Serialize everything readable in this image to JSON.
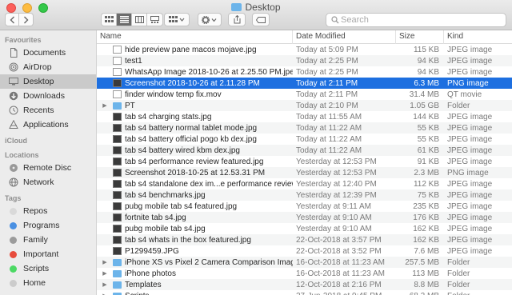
{
  "window": {
    "title": "Desktop"
  },
  "search": {
    "placeholder": "Search"
  },
  "sidebar": {
    "sections": [
      {
        "title": "Favourites",
        "items": [
          {
            "label": "Documents",
            "icon": "documents-icon"
          },
          {
            "label": "AirDrop",
            "icon": "airdrop-icon"
          },
          {
            "label": "Desktop",
            "icon": "desktop-icon",
            "selected": true
          },
          {
            "label": "Downloads",
            "icon": "downloads-icon"
          },
          {
            "label": "Recents",
            "icon": "recents-icon"
          },
          {
            "label": "Applications",
            "icon": "applications-icon"
          }
        ]
      },
      {
        "title": "iCloud",
        "items": []
      },
      {
        "title": "Locations",
        "items": [
          {
            "label": "Remote Disc",
            "icon": "remote-disc-icon"
          },
          {
            "label": "Network",
            "icon": "network-icon"
          }
        ]
      },
      {
        "title": "Tags",
        "items": [
          {
            "label": "Repos",
            "color": "#d9d9d9"
          },
          {
            "label": "Programs",
            "color": "#4a90e2"
          },
          {
            "label": "Family",
            "color": "#9b9b9b"
          },
          {
            "label": "Important",
            "color": "#e74c3c"
          },
          {
            "label": "Scripts",
            "color": "#4cd964"
          },
          {
            "label": "Home",
            "color": "#cccccc"
          }
        ]
      }
    ]
  },
  "columns": {
    "name": "Name",
    "date": "Date Modified",
    "size": "Size",
    "kind": "Kind"
  },
  "files": [
    {
      "name": "hide preview pane macos mojave.jpg",
      "date": "Today at 5:09 PM",
      "size": "115 KB",
      "kind": "JPEG image",
      "type": "doc"
    },
    {
      "name": "test1",
      "date": "Today at 2:25 PM",
      "size": "94 KB",
      "kind": "JPEG image",
      "type": "doc"
    },
    {
      "name": "WhatsApp Image 2018-10-26 at 2.25.50 PM.jpeg",
      "date": "Today at 2:25 PM",
      "size": "94 KB",
      "kind": "JPEG image",
      "type": "doc"
    },
    {
      "name": "Screenshot 2018-10-26 at 2.11.28 PM",
      "date": "Today at 2:11 PM",
      "size": "6.3 MB",
      "kind": "PNG image",
      "type": "img",
      "selected": true
    },
    {
      "name": "finder window temp fix.mov",
      "date": "Today at 2:11 PM",
      "size": "31.4 MB",
      "kind": "QT movie",
      "type": "doc"
    },
    {
      "name": "PT",
      "date": "Today at 2:10 PM",
      "size": "1.05 GB",
      "kind": "Folder",
      "type": "folder",
      "folder": true
    },
    {
      "name": "tab s4 charging stats.jpg",
      "date": "Today at 11:55 AM",
      "size": "144 KB",
      "kind": "JPEG image",
      "type": "img"
    },
    {
      "name": "tab s4 battery normal tablet mode.jpg",
      "date": "Today at 11:22 AM",
      "size": "55 KB",
      "kind": "JPEG image",
      "type": "img"
    },
    {
      "name": "tab s4 battery official pogo kb dex.jpg",
      "date": "Today at 11:22 AM",
      "size": "55 KB",
      "kind": "JPEG image",
      "type": "img"
    },
    {
      "name": "tab s4 battery wired kbm dex.jpg",
      "date": "Today at 11:22 AM",
      "size": "61 KB",
      "kind": "JPEG image",
      "type": "img"
    },
    {
      "name": "tab s4 performance review featured.jpg",
      "date": "Yesterday at 12:53 PM",
      "size": "91 KB",
      "kind": "JPEG image",
      "type": "img"
    },
    {
      "name": "Screenshot 2018-10-25 at 12.53.31 PM",
      "date": "Yesterday at 12:53 PM",
      "size": "2.3 MB",
      "kind": "PNG image",
      "type": "img"
    },
    {
      "name": "tab s4 standalone dex im...e performance review.jpg",
      "date": "Yesterday at 12:40 PM",
      "size": "112 KB",
      "kind": "JPEG image",
      "type": "img"
    },
    {
      "name": "tab s4 benchmarks.jpg",
      "date": "Yesterday at 12:39 PM",
      "size": "75 KB",
      "kind": "JPEG image",
      "type": "img"
    },
    {
      "name": "pubg mobile tab s4 featured.jpg",
      "date": "Yesterday at 9:11 AM",
      "size": "235 KB",
      "kind": "JPEG image",
      "type": "img"
    },
    {
      "name": "fortnite tab s4.jpg",
      "date": "Yesterday at 9:10 AM",
      "size": "176 KB",
      "kind": "JPEG image",
      "type": "img"
    },
    {
      "name": "pubg mobile tab s4.jpg",
      "date": "Yesterday at 9:10 AM",
      "size": "162 KB",
      "kind": "JPEG image",
      "type": "img"
    },
    {
      "name": "tab s4 whats in the box featured.jpg",
      "date": "22-Oct-2018 at 3:57 PM",
      "size": "162 KB",
      "kind": "JPEG image",
      "type": "img"
    },
    {
      "name": "P1299459.JPG",
      "date": "22-Oct-2018 at 3:52 PM",
      "size": "7.6 MB",
      "kind": "JPEG image",
      "type": "img"
    },
    {
      "name": "iPhone XS vs Pixel 2 Camera Comparison Images",
      "date": "16-Oct-2018 at 11:23 AM",
      "size": "257.5 MB",
      "kind": "Folder",
      "type": "folder",
      "folder": true
    },
    {
      "name": "iPhone photos",
      "date": "16-Oct-2018 at 11:23 AM",
      "size": "113 MB",
      "kind": "Folder",
      "type": "folder",
      "folder": true
    },
    {
      "name": "Templates",
      "date": "12-Oct-2018 at 2:16 PM",
      "size": "8.8 MB",
      "kind": "Folder",
      "type": "folder",
      "folder": true
    },
    {
      "name": "Scripts",
      "date": "27-Jun-2018 at 9:45 PM",
      "size": "68.2 MB",
      "kind": "Folder",
      "type": "folder",
      "folder": true
    }
  ]
}
